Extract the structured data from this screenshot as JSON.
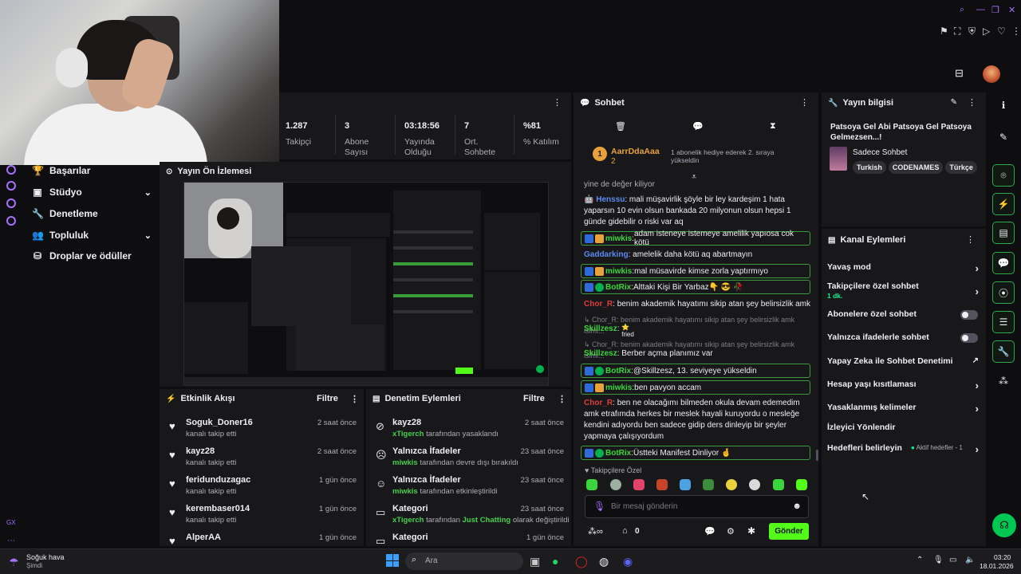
{
  "stats": [
    {
      "value": "1.287",
      "label": "Takipçi"
    },
    {
      "value": "3",
      "label": "Abone Sayısı"
    },
    {
      "value": "03:18:56",
      "label": "Yayında Olduğu"
    },
    {
      "value": "7",
      "label": "Ort. Sohbete"
    },
    {
      "value": "%81",
      "label": "% Katılım"
    }
  ],
  "nav": [
    {
      "label": "Başarılar"
    },
    {
      "label": "Stüdyo"
    },
    {
      "label": "Denetleme"
    },
    {
      "label": "Topluluk"
    },
    {
      "label": "Droplar ve ödüller"
    }
  ],
  "preview": {
    "title": "Yayın Ön İzlemesi"
  },
  "feed": {
    "title": "Etkinlik Akışı",
    "filter": "Filtre",
    "rows": [
      {
        "name": "Soguk_Doner16",
        "sub": "kanalı takip etti",
        "time": "2 saat önce"
      },
      {
        "name": "kayz28",
        "sub": "kanalı takip etti",
        "time": "2 saat önce"
      },
      {
        "name": "feridunduzagac",
        "sub": "kanalı takip etti",
        "time": "1 gün önce"
      },
      {
        "name": "kerembaser014",
        "sub": "kanalı takip etti",
        "time": "1 gün önce"
      },
      {
        "name": "AlperAA",
        "sub": "",
        "time": "1 gün önce"
      }
    ]
  },
  "mod": {
    "title": "Denetim Eylemleri",
    "filter": "Filtre",
    "rows": [
      {
        "name": "kayz28",
        "actor": "xTigerch",
        "sub": "tarafından yasaklandı",
        "time": "2 saat önce"
      },
      {
        "name": "Yalnızca İfadeler",
        "actor": "miwkis",
        "sub": "tarafından devre dışı bırakıldı",
        "time": "23 saat önce"
      },
      {
        "name": "Yalnızca İfadeler",
        "actor": "miwkis",
        "sub": "tarafından etkinleştirildi",
        "time": "23 saat önce"
      },
      {
        "name": "Kategori",
        "actor": "xTigerch",
        "sub": "tarafından",
        "extra": "Just Chatting",
        "sub2": "olarak değiştirildi",
        "time": "23 saat önce"
      },
      {
        "name": "Kategori",
        "actor": "",
        "sub": "",
        "time": "1 gün önce"
      }
    ]
  },
  "chat": {
    "title": "Sohbet",
    "gift_user": "AarrDdaAaa",
    "gift_count": "2",
    "gift_text": "1 abonelik hediye ederek 2. sıraya yükseldin",
    "lines": [
      {
        "user": "",
        "text": "yine de değer kiliyor"
      },
      {
        "user": "Henssu",
        "text": "mali müşavirlik şöyle bir ley kardeşim 1 hata yaparsın 10 evin olsun bankada 20 milyonun olsun hepsi 1 günde gidebilir o riski var aq"
      },
      {
        "user": "miwkis",
        "text": "adam isteneye istemeye amelilik yapıosa cok kötü"
      },
      {
        "user": "Gaddarking",
        "text": "amelelik daha kötü aq abartmayın"
      },
      {
        "user": "miwkis",
        "text": "mal müsavirde kimse zorla yaptırmıyo"
      },
      {
        "user": "BotRix",
        "text": "Alttaki Kişi Bir Yarbaz👇 😎 🥀"
      },
      {
        "user": "Chor_R",
        "text": "benim akademik hayatımı sikip atan şey belirsizlik amk"
      },
      {
        "user": "",
        "text": "Chor_R: benim akademik hayatımı sikip atan şey belirsizlik amk isimi..."
      },
      {
        "user": "Skillzesz",
        "text": "fried"
      },
      {
        "user": "",
        "text": "Chor_R: benim akademik hayatımı sikip atan şey belirsizlik amk isimi..."
      },
      {
        "user": "Skillzesz",
        "text": "Berber açma planımız var"
      },
      {
        "user": "BotRix",
        "text": "@Skillzesz, 13. seviyeye yükseldin"
      },
      {
        "user": "miwkis",
        "text": "ben pavyon accam"
      },
      {
        "user": "Chor_R",
        "text": "ben ne olacağımı bilmeden okula devam edemedim amk etrafımda herkes bir meslek hayali kuruyordu o mesleğe kendini adıyordu ben sadece gidip ders dinleyip bir şeyler yapmaya çalışıyordum"
      },
      {
        "user": "BotRix",
        "text": "Üstteki Manifest Dinliyor 🤞"
      }
    ],
    "followers_label": "Takipçilere Özel",
    "placeholder": "Bir mesaj gönderin",
    "points": "0",
    "send": "Gönder"
  },
  "info": {
    "title": "Yayın bilgisi",
    "stream_title": "Patsoya Gel Abi Patsoya Gel Patsoya Gelmezsen...!",
    "category": "Sadece Sohbet",
    "tags": [
      "Turkish",
      "CODENAMES",
      "Türkçe"
    ]
  },
  "actions": {
    "title": "Kanal Eylemleri",
    "items": [
      {
        "label": "Yavaş mod",
        "type": "chev"
      },
      {
        "label": "Takipçilere özel sohbet",
        "sub": "1 dk.",
        "type": "chev"
      },
      {
        "label": "Abonelere özel sohbet",
        "type": "toggle"
      },
      {
        "label": "Yalnızca ifadelerle sohbet",
        "type": "toggle"
      },
      {
        "label": "Yapay Zeka ile Sohbet Denetimi",
        "type": "ext"
      },
      {
        "label": "Hesap yaşı kısıtlaması",
        "type": "chev"
      },
      {
        "label": "Yasaklanmış kelimeler",
        "type": "chev"
      },
      {
        "label": "İzleyici Yönlendir",
        "type": "none"
      },
      {
        "label": "Hedefleri belirleyin",
        "sub": "Aktif hedefler - 1",
        "type": "chev"
      }
    ]
  },
  "taskbar": {
    "weather": "Soğuk hava",
    "weather_sub": "Şimdi",
    "search": "Ara",
    "time": "03:20",
    "date": "18.01.2026"
  },
  "colors": {
    "accent": "#a970ff",
    "green": "#00f593",
    "send": "#53fc18",
    "bg": "#0e0e10",
    "panel": "#18181b"
  }
}
